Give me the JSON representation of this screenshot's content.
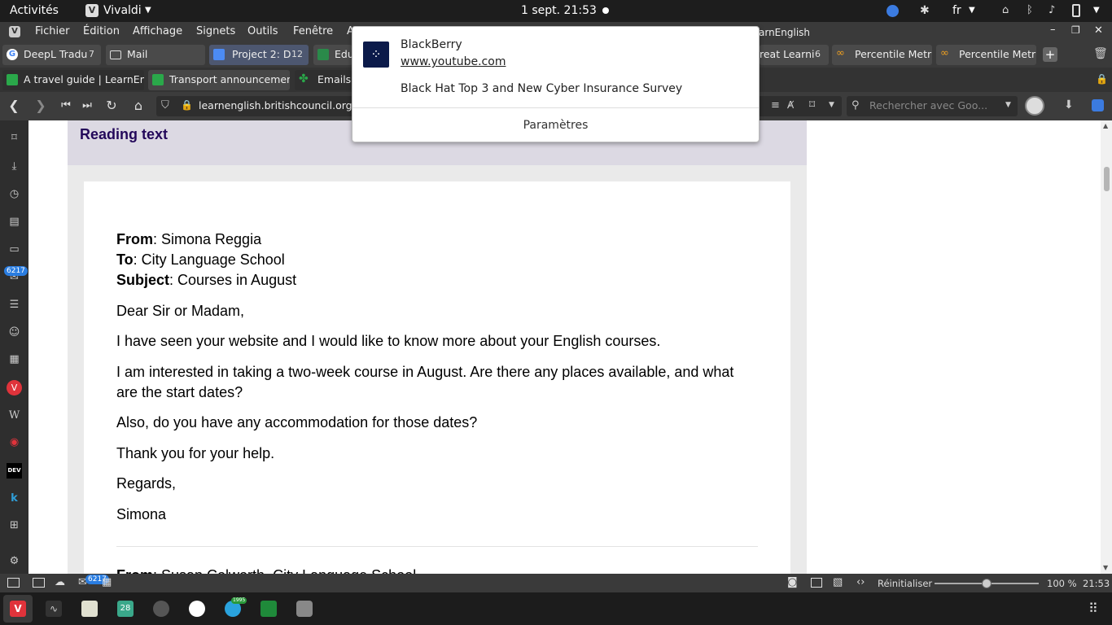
{
  "topbar": {
    "activities": "Activités",
    "app": "Vivaldi",
    "datetime": "1 sept.  21:53",
    "lang": "fr"
  },
  "menubar": {
    "items": [
      "Fichier",
      "Édition",
      "Affichage",
      "Signets",
      "Outils",
      "Fenêtre",
      "A"
    ],
    "window_title_tail": "arnEnglish"
  },
  "tabs_row1": [
    {
      "label": "DeepL Tradu",
      "count": "7"
    },
    {
      "label": "Mail",
      "count": ""
    },
    {
      "label": "Project 2: D",
      "count": "12"
    },
    {
      "label": "Edu",
      "count": ""
    },
    {
      "label": "reat Learni",
      "count": "6"
    },
    {
      "label": "Percentile Metric",
      "count": ""
    },
    {
      "label": "Percentile Metric",
      "count": ""
    }
  ],
  "tabs_row2": [
    {
      "label": "A travel guide | LearnEnglis"
    },
    {
      "label": "Transport announcements"
    },
    {
      "label": "Emails a"
    }
  ],
  "address": {
    "url_domain": "learnenglish.britishcouncil.org",
    "url_path": "/s",
    "search_placeholder": "Rechercher avec Goo..."
  },
  "sidebar": {
    "mail_badge": "6217"
  },
  "page": {
    "section_title": "Reading text",
    "email1": {
      "from_label": "From",
      "from_value": ": Simona Reggia",
      "to_label": "To",
      "to_value": ": City Language School",
      "subject_label": "Subject",
      "subject_value": ": Courses in August",
      "greeting": "Dear Sir or Madam,",
      "p1": "I have seen your website and I would like to know more about your English courses.",
      "p2a": "I am interested in taking a two-week course in August. Are there any places available, and what",
      "p2b": "are the start dates?",
      "p3": "Also, do you have any accommodation for those dates?",
      "p4": "Thank you for your help.",
      "closing": "Regards,",
      "signature": "Simona"
    },
    "email2": {
      "from_label": "From",
      "from_value": ": Susan Colworth, City Language School"
    }
  },
  "statusbar": {
    "reset": "Réinitialiser",
    "zoom": "100 %",
    "time": "21:53",
    "mail_badge": "6217",
    "zoom_level": 0.5
  },
  "dock": {
    "calendar_day": "28",
    "telegram_badge": "1995"
  },
  "notification": {
    "app": "BlackBerry",
    "source": "www.youtube.com",
    "body": "Black Hat Top 3 and New Cyber Insurance Survey",
    "settings": "Paramètres"
  }
}
